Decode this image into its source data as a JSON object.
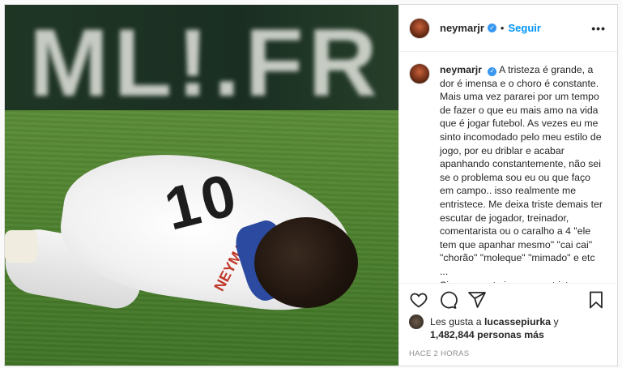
{
  "post": {
    "username": "neymarjr",
    "follow_label": "Seguir",
    "dot": "•",
    "more_label": "•••",
    "verified_mark": "✓",
    "photo": {
      "banner_text": "ML!.FR",
      "shirt_number": "10",
      "shirt_name": "NEYMAR"
    },
    "caption": {
      "username": "neymarjr",
      "text": "A tristeza é grande, a dor é imensa e o choro é constante. Mais uma vez pararei por um tempo de fazer o que eu mais amo na vida que é jogar futebol. As vezes eu me sinto incomodado pelo meu estilo de jogo, por eu driblar e acabar apanhando constantemente, não sei se o problema sou eu ou que faço em campo.. isso realmente me entristece. Me deixa triste demais ter escutar de jogador, treinador, comentarista ou o caralho a 4 \"ele tem que apanhar mesmo\" \"cai cai\" \"chorão\" \"moleque\" \"mimado\" e etc ...\nSinceramente isso me entristece e não sei até quando aguentarei, eu só quero ser feliz jogando futebol. NADA MAIS"
    },
    "actions": [
      "heart-icon",
      "comment-icon",
      "share-icon",
      "save-icon"
    ],
    "likes": {
      "prefix": "Les gusta a",
      "user": "lucassepiurka",
      "connector": "y",
      "count": "1,482,844 personas más"
    },
    "time": "HACE 2 HORAS",
    "colors": {
      "link": "#0095f6",
      "verified": "#3897f0",
      "text": "#262626",
      "muted": "#8e8e8e"
    }
  }
}
